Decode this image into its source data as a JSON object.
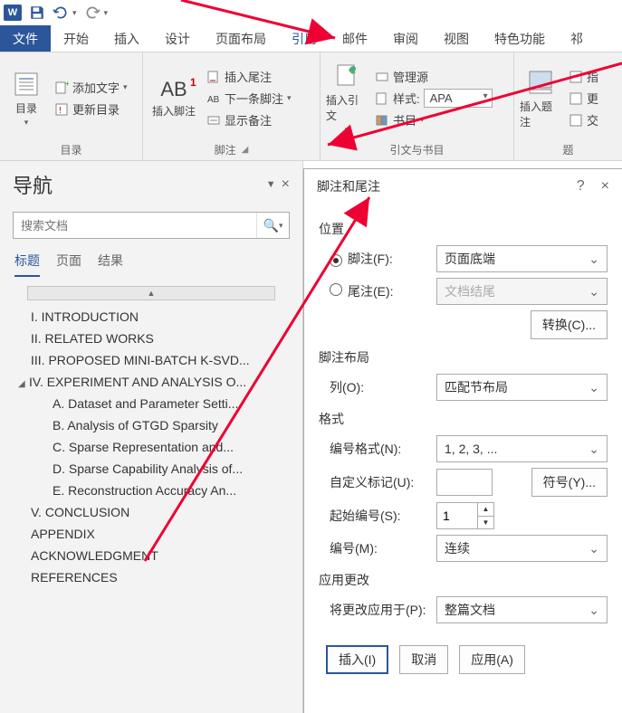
{
  "titlebar": {
    "app": "W"
  },
  "ribbon_tabs": {
    "file": "文件",
    "home": "开始",
    "insert": "插入",
    "design": "设计",
    "layout": "页面布局",
    "references": "引用",
    "mailings": "邮件",
    "review": "审阅",
    "view": "视图",
    "special": "特色功能",
    "more": "祁"
  },
  "ribbon": {
    "toc": {
      "big": "目录",
      "add_text": "添加文字",
      "update": "更新目录",
      "group": "目录"
    },
    "footnotes": {
      "big": "插入脚注",
      "ab": "AB",
      "sup": "1",
      "insert_endnote": "插入尾注",
      "next_footnote": "下一条脚注",
      "show_notes": "显示备注",
      "group": "脚注"
    },
    "citations": {
      "big": "插入引文",
      "manage": "管理源",
      "style": "样式:",
      "style_val": "APA",
      "biblio": "书目",
      "group": "引文与书目"
    },
    "captions": {
      "big": "插入题注",
      "insert_tof": "指",
      "update_tof": "更",
      "cross_ref": "交",
      "group": "题"
    }
  },
  "nav": {
    "title": "导航",
    "search_placeholder": "搜索文档",
    "tabs": {
      "headings": "标题",
      "pages": "页面",
      "results": "结果"
    },
    "collapse": "▲",
    "outline": [
      {
        "t": "I. INTRODUCTION",
        "l": 1
      },
      {
        "t": "II. RELATED WORKS",
        "l": 1
      },
      {
        "t": "III. PROPOSED MINI-BATCH K-SVD...",
        "l": 1
      },
      {
        "t": "IV. EXPERIMENT AND ANALYSIS O...",
        "l": 1,
        "exp": true
      },
      {
        "t": "A. Dataset and Parameter Setti...",
        "l": 2
      },
      {
        "t": "B. Analysis of GTGD Sparsity",
        "l": 2
      },
      {
        "t": "C. Sparse Representation and...",
        "l": 2
      },
      {
        "t": "D. Sparse Capability Analysis of...",
        "l": 2
      },
      {
        "t": "E. Reconstruction Accuracy An...",
        "l": 2
      },
      {
        "t": "V. CONCLUSION",
        "l": 1
      },
      {
        "t": "APPENDIX",
        "l": 1
      },
      {
        "t": "ACKNOWLEDGMENT",
        "l": 1
      },
      {
        "t": "REFERENCES",
        "l": 1
      }
    ]
  },
  "dialog": {
    "title": "脚注和尾注",
    "help": "?",
    "close": "×",
    "position": "位置",
    "footnote": "脚注(F):",
    "footnote_val": "页面底端",
    "endnote": "尾注(E):",
    "endnote_val": "文档结尾",
    "convert": "转换(C)...",
    "layout": "脚注布局",
    "columns": "列(O):",
    "columns_val": "匹配节布局",
    "format": "格式",
    "num_format": "编号格式(N):",
    "num_format_val": "1, 2, 3, ...",
    "custom_mark": "自定义标记(U):",
    "symbol": "符号(Y)...",
    "start_at": "起始编号(S):",
    "start_at_val": "1",
    "numbering": "编号(M):",
    "numbering_val": "连续",
    "apply": "应用更改",
    "apply_to": "将更改应用于(P):",
    "apply_to_val": "整篇文档",
    "insert": "插入(I)",
    "cancel": "取消",
    "apply_btn": "应用(A)"
  },
  "watermark": ""
}
